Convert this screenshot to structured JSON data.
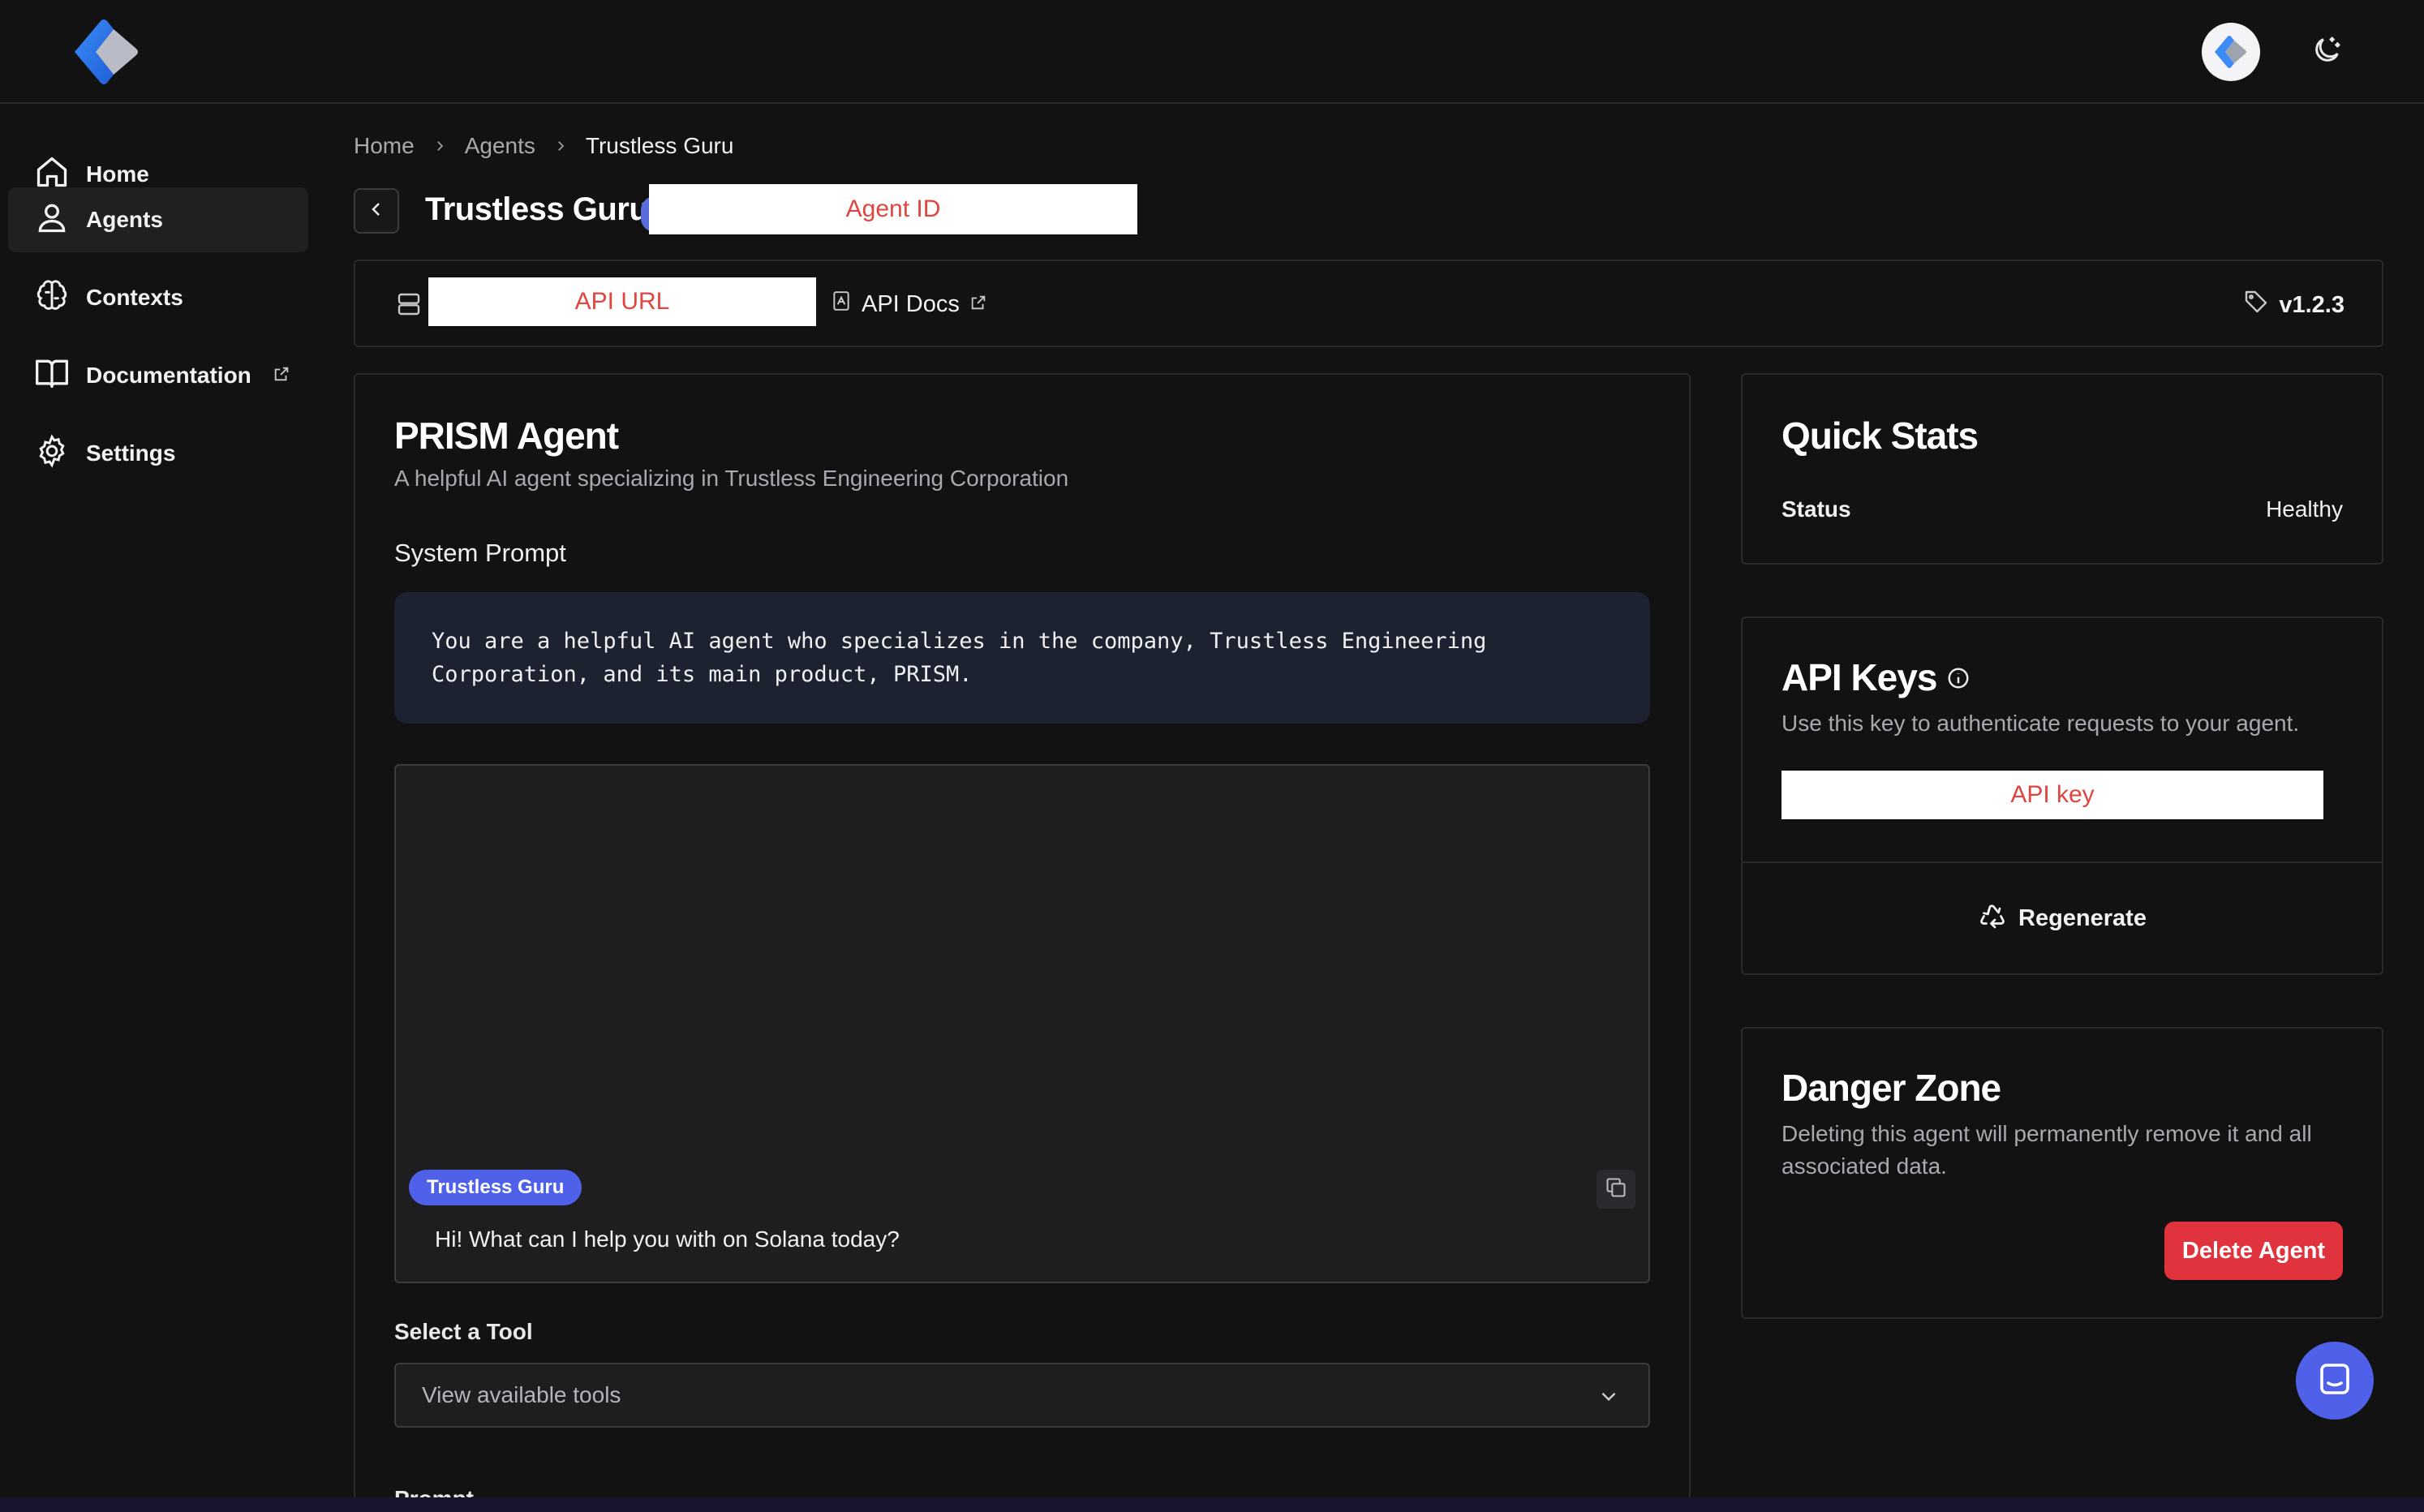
{
  "sidebar": {
    "items": [
      {
        "label": "Home",
        "icon": "home-icon"
      },
      {
        "label": "Agents",
        "icon": "user-icon"
      },
      {
        "label": "Contexts",
        "icon": "brain-icon"
      },
      {
        "label": "Documentation",
        "icon": "book-icon"
      },
      {
        "label": "Settings",
        "icon": "gear-icon"
      }
    ]
  },
  "breadcrumb": {
    "items": [
      "Home",
      "Agents",
      "Trustless Guru"
    ]
  },
  "header": {
    "title": "Trustless Guru",
    "agent_id_redacted": "Agent ID"
  },
  "info_bar": {
    "api_url_redacted": "API URL",
    "api_docs_label": "API Docs",
    "version": "v1.2.3"
  },
  "agent": {
    "name": "PRISM Agent",
    "description": "A helpful AI agent specializing in Trustless Engineering Corporation",
    "system_prompt_label": "System Prompt",
    "system_prompt_line1": "You are a helpful AI agent who specializes in the company, Trustless Engineering",
    "system_prompt_line2": "Corporation, and its main product, PRISM.",
    "chat_sender": "Trustless Guru",
    "chat_message": "Hi! What can I help you with on Solana today?",
    "tool_label": "Select a Tool",
    "tool_placeholder": "View available tools",
    "prompt_label": "Prompt"
  },
  "quick_stats": {
    "title": "Quick Stats",
    "status_label": "Status",
    "status_value": "Healthy"
  },
  "api_keys": {
    "title": "API Keys",
    "description": "Use this key to authenticate requests to your agent.",
    "key_redacted": "API key",
    "regenerate_label": "Regenerate"
  },
  "danger_zone": {
    "title": "Danger Zone",
    "description_line1": "Deleting this agent will permanently remove it and all",
    "description_line2": "associated data.",
    "delete_label": "Delete Agent"
  },
  "colors": {
    "accent": "#4f61e8",
    "danger": "#e0333d",
    "background": "#121212"
  }
}
